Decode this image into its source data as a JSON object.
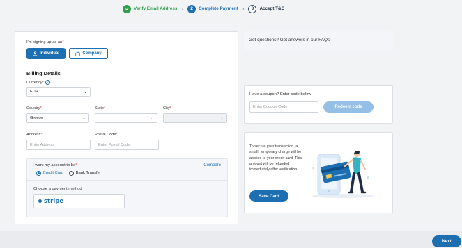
{
  "stepper": {
    "steps": [
      {
        "number": "1",
        "label": "Verify Email Address",
        "state": "done"
      },
      {
        "number": "2",
        "label": "Complete Payment",
        "state": "active"
      },
      {
        "number": "3",
        "label": "Accept T&C",
        "state": "pending"
      }
    ]
  },
  "signup": {
    "label": "I'm signing up as an",
    "required_mark": "*",
    "options": {
      "individual": "Individual",
      "company": "Company"
    },
    "selected": "Individual"
  },
  "billing": {
    "title": "Billing Details",
    "currency": {
      "label": "Currency",
      "value": "EUR"
    },
    "country": {
      "label": "Country",
      "value": "Greece"
    },
    "state": {
      "label": "State",
      "value": ""
    },
    "city": {
      "label": "City",
      "value": ""
    },
    "address": {
      "label": "Address",
      "placeholder": "Enter Address"
    },
    "postal": {
      "label": "Postal Code",
      "placeholder": "Enter Postal Code"
    }
  },
  "payment": {
    "title": "I want my account to be",
    "compare": "Compare",
    "options": {
      "credit": "Credit Card",
      "bank": "Bank Transfer"
    },
    "selected": "Credit Card",
    "method_label": "Choose a payment method",
    "method": "stripe"
  },
  "faq": {
    "text": "Got questions? Get answers in our  FAQs"
  },
  "coupon": {
    "label": "Have a coupon? Enter code below",
    "placeholder": "Enter Coupon Code",
    "redeem": "Redeem code"
  },
  "save_card": {
    "text": "To secure your transaction, a small, temporary charge will be applied to your credit card. This amount will be refunded immediately after verification.",
    "button": "Save Card"
  },
  "footer": {
    "next": "Next"
  },
  "colors": {
    "primary": "#1d6fb2",
    "success": "#2e9f4a",
    "required": "#d93b3b"
  }
}
